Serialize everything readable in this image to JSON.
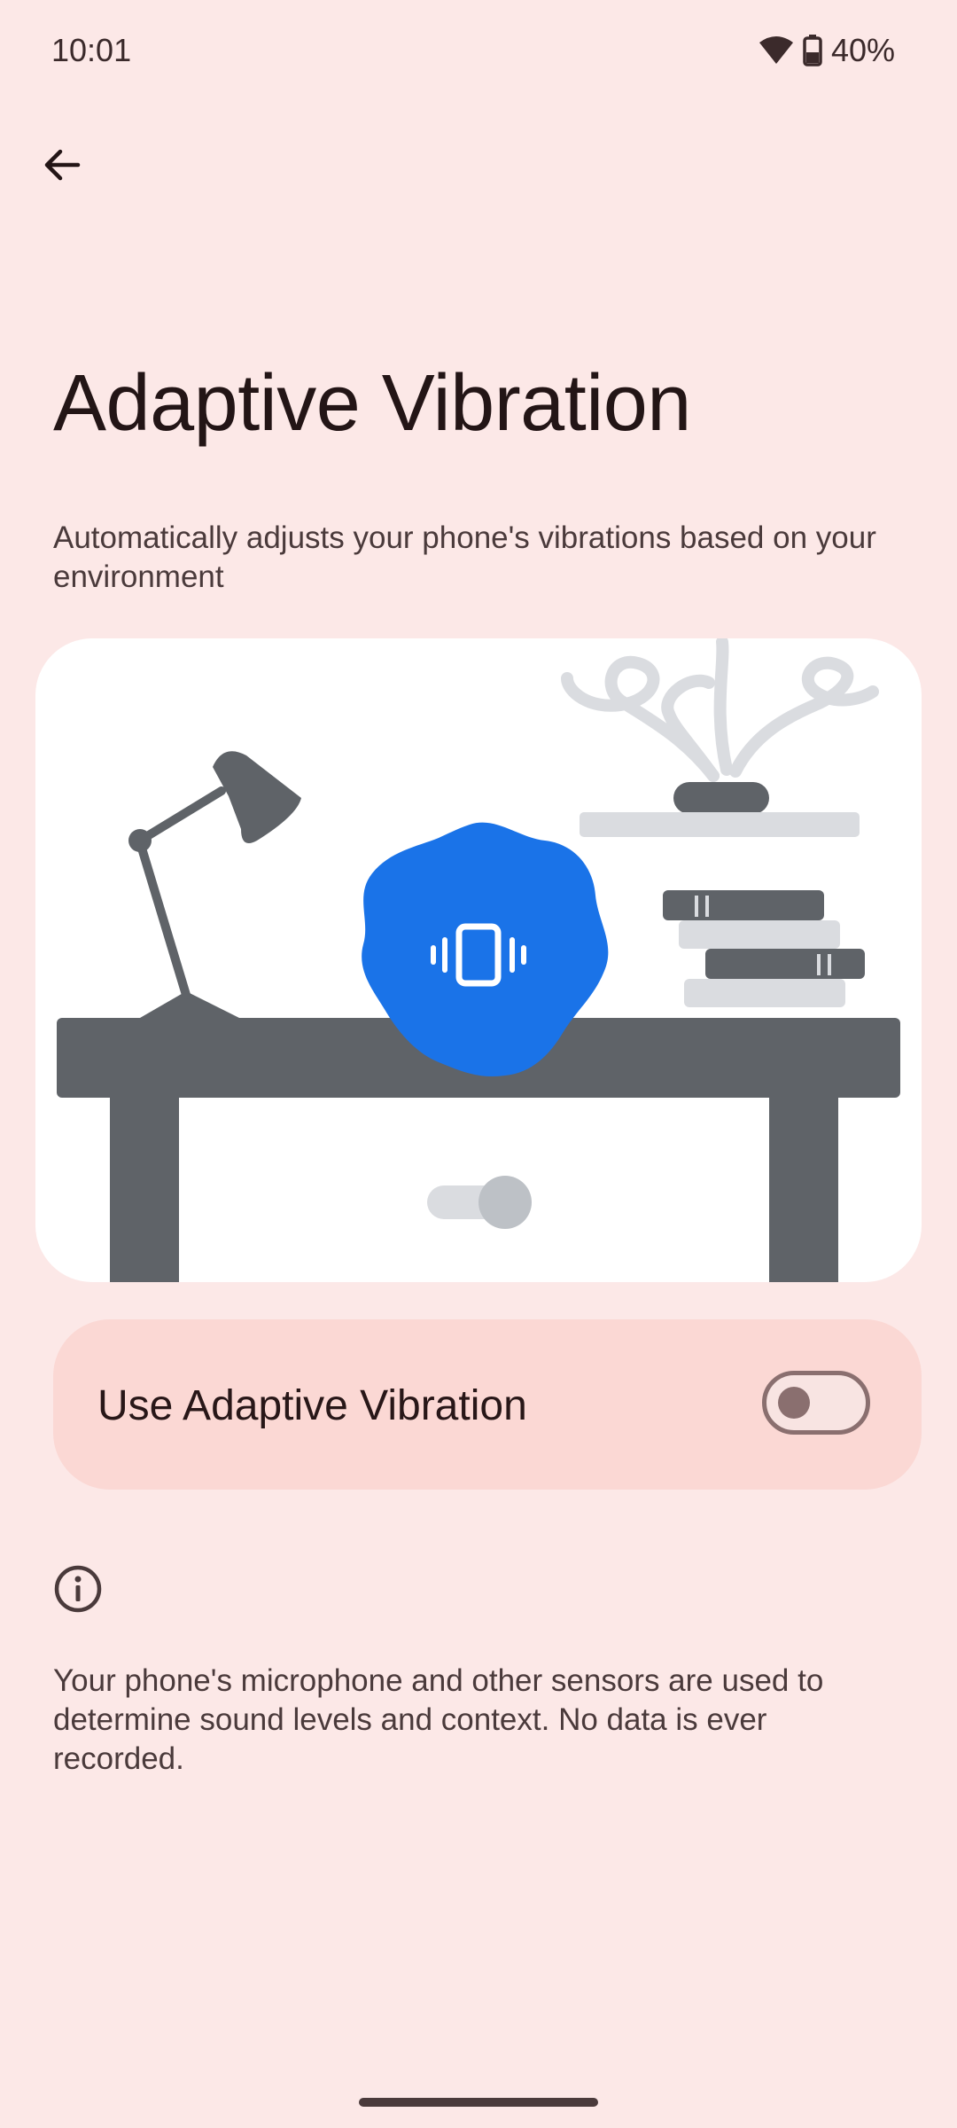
{
  "status_bar": {
    "time": "10:01",
    "battery_percent": "40%",
    "icons": [
      "wifi-icon",
      "battery-icon"
    ]
  },
  "navigation": {
    "back_icon": "arrow-left-icon"
  },
  "page": {
    "title": "Adaptive Vibration",
    "description": "Automatically adjusts your phone's vibrations based on your environment"
  },
  "illustration": {
    "icon": "vibration-icon",
    "colors": {
      "badge": "#1A73E8",
      "dark_gray": "#5F6368",
      "light_gray": "#DADCE0"
    }
  },
  "setting": {
    "label": "Use Adaptive Vibration",
    "enabled": false
  },
  "info": {
    "icon": "info-icon",
    "text": "Your phone's microphone and other sensors are used to determine sound levels and context. No data is ever recorded."
  },
  "colors": {
    "background": "#FCE8E7",
    "card": "#FBD8D4",
    "text": "#281718"
  }
}
